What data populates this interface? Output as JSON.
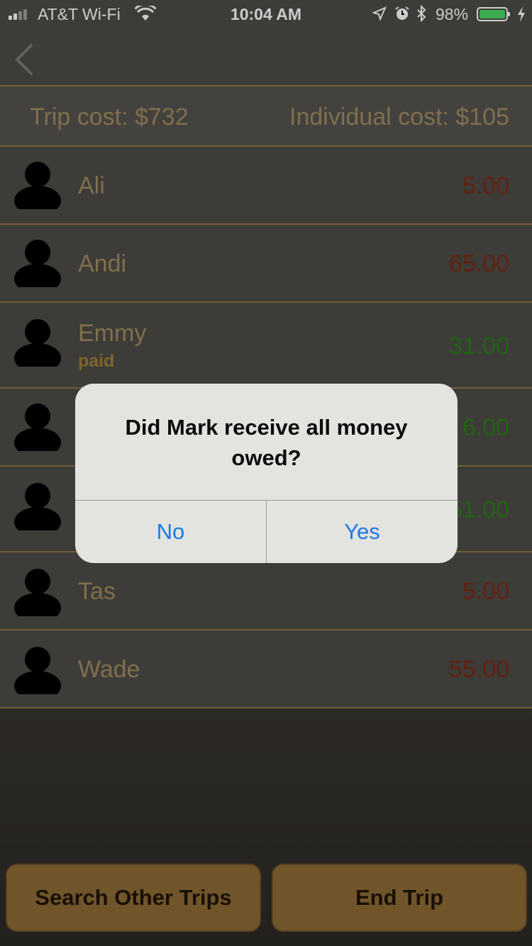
{
  "status_bar": {
    "carrier": "AT&T Wi-Fi",
    "time": "10:04 AM",
    "battery": "98%"
  },
  "header": {
    "trip_cost": "Trip cost: $732",
    "individual_cost": "Individual cost: $105"
  },
  "members": [
    {
      "name": "Ali",
      "amount": "5.00",
      "status": "",
      "color": "#7a2a14"
    },
    {
      "name": "Andi",
      "amount": "65.00",
      "status": "",
      "color": "#7a2a14"
    },
    {
      "name": "Emmy",
      "amount": "31.00",
      "status": "paid",
      "color": "#2b7d1a"
    },
    {
      "name": "",
      "amount": "6.00",
      "status": "",
      "color": "#2b7d1a"
    },
    {
      "name": "",
      "amount": "51.00",
      "status": "",
      "color": "#2b7d1a"
    },
    {
      "name": "Tas",
      "amount": "5.00",
      "status": "",
      "color": "#7a2a14"
    },
    {
      "name": "Wade",
      "amount": "55.00",
      "status": "",
      "color": "#7a2a14"
    }
  ],
  "alert": {
    "title": "Did Mark receive all money owed?",
    "no_label": "No",
    "yes_label": "Yes",
    "button_color": "#1a7ae6"
  },
  "bottom": {
    "search_label": "Search Other Trips",
    "end_label": "End Trip"
  },
  "colors": {
    "accent": "#8c6b36",
    "text_gold": "#a08b62",
    "owes": "#7a2a14",
    "credit": "#2b7d1a"
  }
}
